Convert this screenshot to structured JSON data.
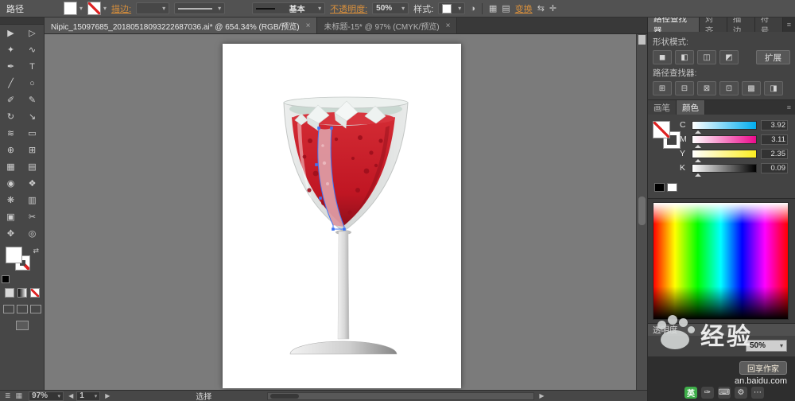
{
  "control_bar": {
    "selection_type": "路径",
    "stroke_label": "描边:",
    "brush_name": "基本",
    "opacity_label": "不透明度:",
    "opacity_value": "50%",
    "style_label": "样式:",
    "transform_label": "变换"
  },
  "doc_tabs": [
    {
      "title": "Nipic_15097685_20180518093222687036.ai* @ 654.34% (RGB/预览)",
      "close": "×"
    },
    {
      "title": "未标题-15* @ 97% (CMYK/预览)",
      "close": "×"
    }
  ],
  "tools": [
    {
      "name": "selection-tool",
      "glyph": "▶"
    },
    {
      "name": "direct-selection-tool",
      "glyph": "▷"
    },
    {
      "name": "magic-wand-tool",
      "glyph": "✦"
    },
    {
      "name": "lasso-tool",
      "glyph": "∿"
    },
    {
      "name": "pen-tool",
      "glyph": "✒"
    },
    {
      "name": "type-tool",
      "glyph": "T"
    },
    {
      "name": "line-tool",
      "glyph": "╱"
    },
    {
      "name": "ellipse-tool",
      "glyph": "○"
    },
    {
      "name": "paintbrush-tool",
      "glyph": "✐"
    },
    {
      "name": "pencil-tool",
      "glyph": "✎"
    },
    {
      "name": "rotate-tool",
      "glyph": "↻"
    },
    {
      "name": "scale-tool",
      "glyph": "↘"
    },
    {
      "name": "width-tool",
      "glyph": "≋"
    },
    {
      "name": "free-transform-tool",
      "glyph": "▭"
    },
    {
      "name": "shape-builder-tool",
      "glyph": "⊕"
    },
    {
      "name": "perspective-grid-tool",
      "glyph": "⊞"
    },
    {
      "name": "mesh-tool",
      "glyph": "▦"
    },
    {
      "name": "gradient-tool",
      "glyph": "▤"
    },
    {
      "name": "eyedropper-tool",
      "glyph": "◉"
    },
    {
      "name": "blend-tool",
      "glyph": "❖"
    },
    {
      "name": "symbol-sprayer-tool",
      "glyph": "❋"
    },
    {
      "name": "graph-tool",
      "glyph": "▥"
    },
    {
      "name": "artboard-tool",
      "glyph": "▣"
    },
    {
      "name": "slice-tool",
      "glyph": "✂"
    },
    {
      "name": "hand-tool",
      "glyph": "✥"
    },
    {
      "name": "zoom-tool",
      "glyph": "◎"
    }
  ],
  "panels": {
    "pathfinder": {
      "tabs": [
        "路径查找器",
        "对齐",
        "描边",
        "符号"
      ],
      "shape_modes_label": "形状模式:",
      "expand_button": "扩展",
      "pathfinders_label": "路径查找器:",
      "shape_modes": [
        {
          "name": "unite",
          "glyph": "◼"
        },
        {
          "name": "minus-front",
          "glyph": "◧"
        },
        {
          "name": "intersect",
          "glyph": "◫"
        },
        {
          "name": "exclude",
          "glyph": "◩"
        }
      ],
      "pathfinders": [
        {
          "name": "divide",
          "glyph": "⊞"
        },
        {
          "name": "trim",
          "glyph": "⊟"
        },
        {
          "name": "merge",
          "glyph": "⊠"
        },
        {
          "name": "crop",
          "glyph": "⊡"
        },
        {
          "name": "outline",
          "glyph": "▩"
        },
        {
          "name": "minus-back",
          "glyph": "◨"
        }
      ]
    },
    "color": {
      "tabs": [
        "画笔",
        "颜色"
      ],
      "channels": [
        {
          "label": "C",
          "value": "3.92"
        },
        {
          "label": "M",
          "value": "3.11"
        },
        {
          "label": "Y",
          "value": "2.35"
        },
        {
          "label": "K",
          "value": "0.09"
        }
      ]
    },
    "transparency": {
      "title": "透明度",
      "opacity_value": "50%"
    }
  },
  "watermark": {
    "brand": "经验",
    "button_label": "回享作家",
    "url": "an.baidu.com"
  },
  "status_bar": {
    "zoom": "97%",
    "artboard_number": "1",
    "status_text": "选择"
  },
  "tray": [
    {
      "name": "ime-language-icon",
      "glyph": "英"
    },
    {
      "name": "handwriting-icon",
      "glyph": "✑"
    },
    {
      "name": "keyboard-icon",
      "glyph": "⌨"
    },
    {
      "name": "settings-wrench-icon",
      "glyph": "⚙"
    },
    {
      "name": "more-icon",
      "glyph": "⋯"
    }
  ],
  "icons": {
    "dropdown": "▾",
    "menu": "≡",
    "swap": "⇄",
    "list": "≣",
    "arrow_left": "◀",
    "arrow_right": "▶",
    "recolor": "◑",
    "grid": "▦",
    "rows": "▤",
    "shuffle": "⇆",
    "crosshair": "✛"
  },
  "artwork": {
    "wine_red": "#c01623",
    "wine_dark": "#8f0f1b",
    "glass_gray": "#d9dcdb",
    "highlight_pink": "#dd9aa2",
    "selection_blue": "#3f74f5"
  }
}
